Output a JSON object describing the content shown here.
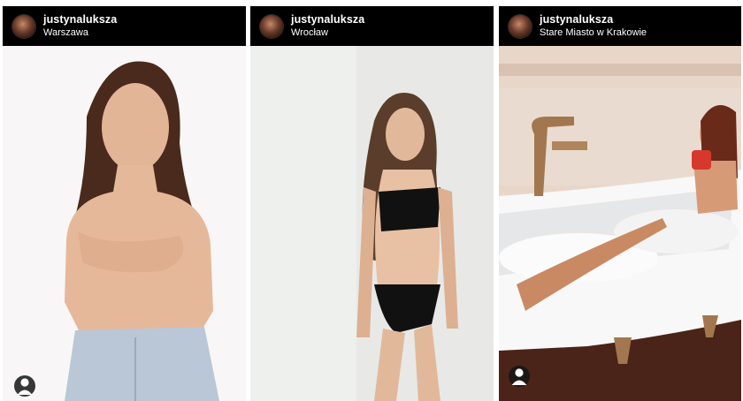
{
  "posts": [
    {
      "username": "justynalukszа",
      "location": "Warszawa",
      "icon": "user-tag-icon"
    },
    {
      "username": "justynalukszа",
      "location": "Wrocław"
    },
    {
      "username": "justynaluksza",
      "location": "Stare Miasto w Krakowie",
      "icon": "user-tag-icon"
    }
  ]
}
